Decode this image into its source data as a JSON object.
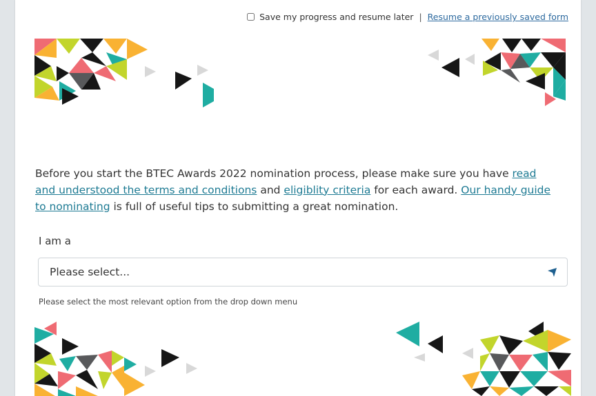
{
  "save_bar": {
    "checkbox_label": "Save my progress and resume later",
    "separator": "|",
    "resume_link": "Resume a previously saved form"
  },
  "intro": {
    "text_1": "Before you start the BTEC Awards 2022 nomination process, please make sure you have ",
    "link_terms": "read and understood the terms and conditions",
    "text_2": " and ",
    "link_criteria": "eligiblity criteria",
    "text_3": " for each award. ",
    "link_guide": "Our handy guide to nominating",
    "text_4": " is full of useful tips to submitting a great nomination."
  },
  "form": {
    "field_label": "I am a",
    "select_value": "Please select...",
    "help_text": "Please select the most relevant option from the drop down menu"
  },
  "colors": {
    "pink": "#ef6b73",
    "yellow": "#f9b233",
    "lime": "#c2d52c",
    "teal": "#1fada2",
    "black": "#161616",
    "grey": "#58595b",
    "light_grey": "#d8d8d8",
    "link": "#1d7a93"
  }
}
